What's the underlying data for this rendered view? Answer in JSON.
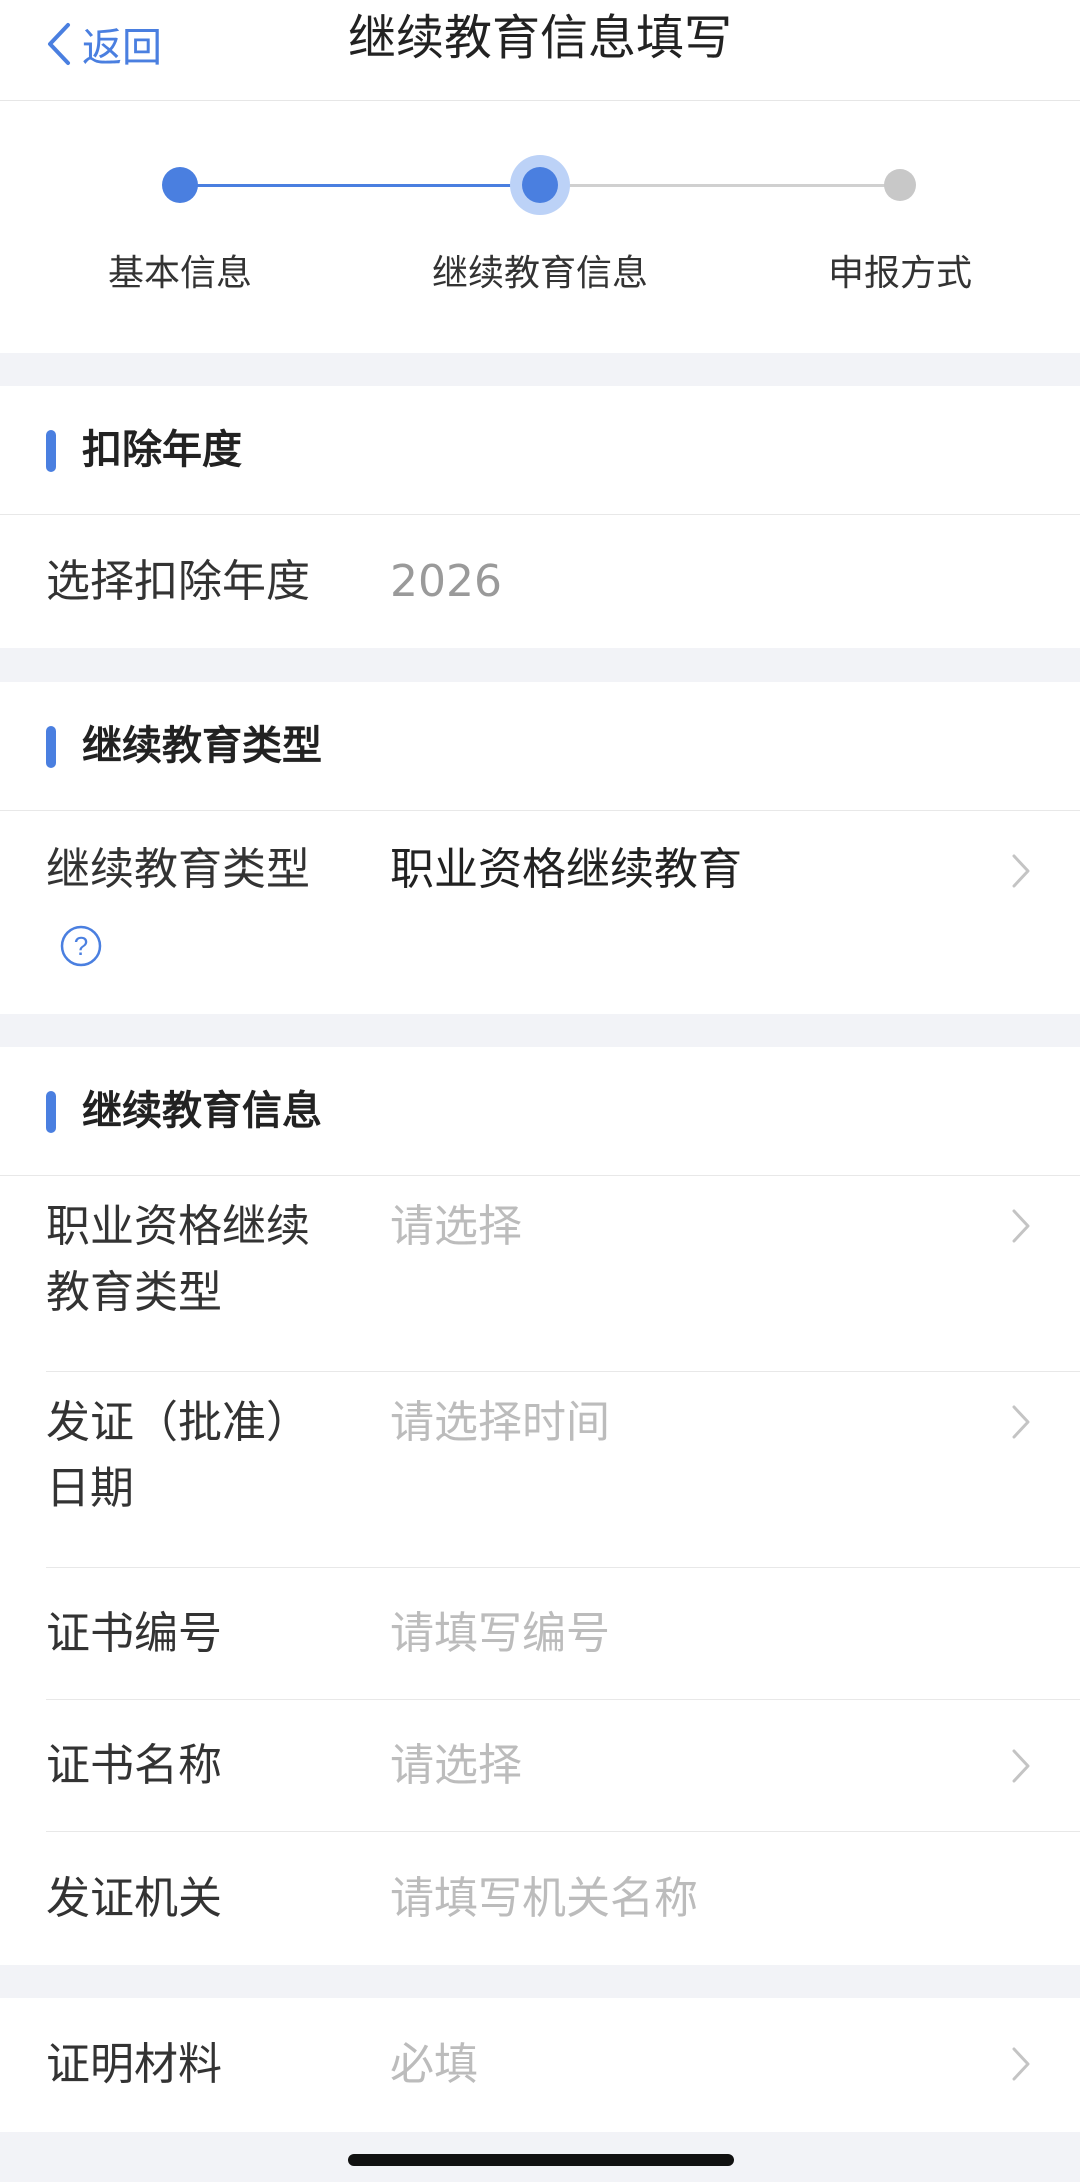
{
  "nav": {
    "back_label": "返回",
    "title": "继续教育信息填写"
  },
  "steps": [
    {
      "label": "基本信息",
      "state": "done"
    },
    {
      "label": "继续教育信息",
      "state": "current"
    },
    {
      "label": "申报方式",
      "state": "todo"
    }
  ],
  "section_year": {
    "title": "扣除年度",
    "row": {
      "label": "选择扣除年度",
      "value": "2026"
    }
  },
  "section_type": {
    "title": "继续教育类型",
    "row": {
      "label": "继续教育类型",
      "value": "职业资格继续教育"
    }
  },
  "section_info": {
    "title": "继续教育信息",
    "rows": [
      {
        "label_line1": "职业资格继续",
        "label_line2": "教育类型",
        "placeholder": "请选择"
      },
      {
        "label_line1": "发证（批准）",
        "label_line2": "日期",
        "placeholder": "请选择时间"
      },
      {
        "label": "证书编号",
        "placeholder": "请填写编号"
      },
      {
        "label": "证书名称",
        "placeholder": "请选择"
      },
      {
        "label": "发证机关",
        "placeholder": "请填写机关名称"
      }
    ]
  },
  "section_proof": {
    "row": {
      "label": "证明材料",
      "placeholder": "必填"
    }
  },
  "colors": {
    "accent": "#4a7fe0",
    "inactive": "#c8c8c8",
    "background": "#f2f3f7"
  }
}
